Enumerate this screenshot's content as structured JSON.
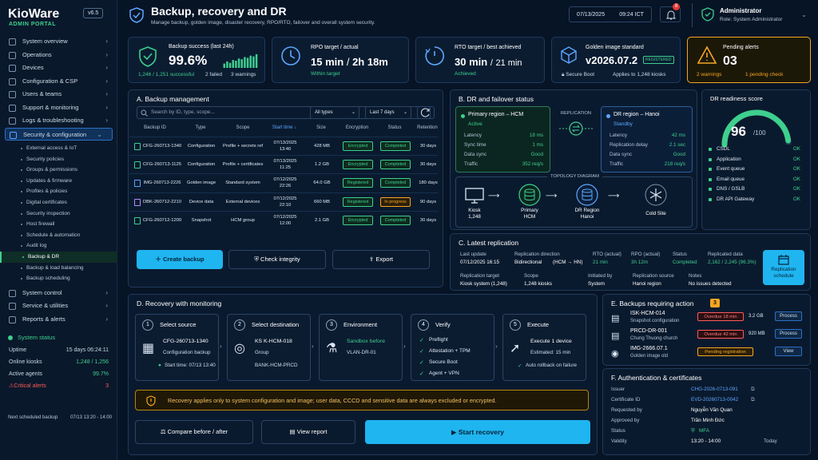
{
  "sidebar": {
    "logo": "KioWare",
    "logo_sub": "ADMIN PORTAL",
    "version": "v6.5",
    "items": [
      {
        "label": "System overview"
      },
      {
        "label": "Operations"
      },
      {
        "label": "Devices"
      },
      {
        "label": "Configuration & CSP"
      },
      {
        "label": "Users & teams"
      },
      {
        "label": "Support & monitoring"
      },
      {
        "label": "Logs & troubleshooting"
      },
      {
        "label": "Security & configuration"
      }
    ],
    "subitems": [
      "External access & IoT",
      "Security policies",
      "Groups & permissions",
      "Updates & firmware",
      "Profiles & policies",
      "Digital certificates",
      "Security inspection",
      "Host firewall",
      "Schedule & automation",
      "Audit log",
      "Backup & DR",
      "Backup & load balancing",
      "Backup scheduling"
    ],
    "bottom_items": [
      {
        "label": "System control"
      },
      {
        "label": "Service & utilities"
      },
      {
        "label": "Reports & alerts"
      }
    ],
    "status": {
      "title": "System status",
      "rows": [
        {
          "k": "Uptime",
          "v": "15 days 06:24:11"
        },
        {
          "k": "Online kiosks",
          "v": "1,248 / 1,256"
        },
        {
          "k": "Active agents",
          "v": "99.7%"
        },
        {
          "k": "Critical alerts",
          "v": "3"
        }
      ],
      "sched_label": "Next scheduled backup",
      "sched_value": "07/13 13:20 - 14:00"
    }
  },
  "header": {
    "title": "Backup, recovery and DR",
    "subtitle": "Manage backup, golden image, disaster recovery, RPO/RTO, failover and overall system security.",
    "date": "07/13/2025",
    "time": "09:24 ICT",
    "notif": "8",
    "user_name": "Administrator",
    "user_role": "Role: System Administrator"
  },
  "kpis": {
    "backup": {
      "title": "Backup success (last 24h)",
      "value": "99.6%",
      "ok": "1,246 / 1,251 successful",
      "failed": "2 failed",
      "warn": "3 warnings",
      "bars": [
        0.3,
        0.45,
        0.35,
        0.55,
        0.5,
        0.65,
        0.6,
        0.75,
        0.7,
        0.85,
        0.8,
        0.95
      ]
    },
    "rpo": {
      "title": "RPO target / actual",
      "value": "15 min",
      "value2": "2h 18m",
      "status": "Within target"
    },
    "rto": {
      "title": "RTO target / best achieved",
      "value": "30 min",
      "value2": "21 min",
      "status": "Achieved"
    },
    "golden": {
      "title": "Golden image standard",
      "value": "v2026.07.2",
      "badge": "REGISTERED",
      "s1": "Secure Boot",
      "s2": "Applies to 1,248 kiosks"
    },
    "alerts": {
      "title": "Pending alerts",
      "value": "03",
      "s1": "2 warnings",
      "s2": "1 pending check"
    }
  },
  "backup": {
    "title": "A. Backup management",
    "search_placeholder": "Search by ID, type, scope...",
    "filter_type": "All types",
    "filter_date": "Last 7 days",
    "columns": [
      "Backup ID",
      "Type",
      "Scope",
      "Start time",
      "Size",
      "Encryption",
      "Status",
      "Retention"
    ],
    "rows": [
      {
        "id": "CFG-260713-1340",
        "type": "Configuration",
        "scope": "Profile + secrets ref",
        "d": "07/13/2025",
        "t": "13:40",
        "size": "428 MB",
        "enc": "Encrypted",
        "status": "Completed",
        "ret": "30 days"
      },
      {
        "id": "CFG-260713-1125",
        "type": "Configuration",
        "scope": "Profile + certificates",
        "d": "07/13/2025",
        "t": "11:25",
        "size": "1.2 GB",
        "enc": "Encrypted",
        "status": "Completed",
        "ret": "30 days"
      },
      {
        "id": "IMG-260713-2226",
        "type": "Golden image",
        "scope": "Standard system",
        "d": "07/12/2025",
        "t": "22:26",
        "size": "64.0 GB",
        "enc": "Registered",
        "status": "Completed",
        "ret": "180 days"
      },
      {
        "id": "DBK-260712-2210",
        "type": "Device data",
        "scope": "External devices",
        "d": "07/12/2025",
        "t": "22:10",
        "size": "660 MB",
        "enc": "Registered",
        "status": "In progress",
        "ret": "90 days"
      },
      {
        "id": "CFG-260712-1200",
        "type": "Snapshot",
        "scope": "HCM group",
        "d": "07/12/2025",
        "t": "12:00",
        "size": "2.1 GB",
        "enc": "Encrypted",
        "status": "Completed",
        "ret": "30 days"
      }
    ],
    "btn_create": "Create backup",
    "btn_check": "Check integrity",
    "btn_export": "Export"
  },
  "dr": {
    "title": "B. DR and failover status",
    "primary": {
      "name": "Primary region – HCM",
      "state": "Active",
      "rows": [
        {
          "k": "Latency",
          "v": "18 ms"
        },
        {
          "k": "Sync time",
          "v": "1 ms"
        },
        {
          "k": "Data sync",
          "v": "Good"
        },
        {
          "k": "Traffic",
          "v": "352 req/s"
        }
      ]
    },
    "replication": "REPLICATION",
    "secondary": {
      "name": "DR region – Hanoi",
      "state": "Standby",
      "rows": [
        {
          "k": "Latency",
          "v": "42 ms"
        },
        {
          "k": "Replication delay",
          "v": "2.1 sec"
        },
        {
          "k": "Data sync",
          "v": "Good"
        },
        {
          "k": "Traffic",
          "v": "218 req/s"
        }
      ]
    },
    "topology": "TOPOLOGY DIAGRAM",
    "nodes": [
      {
        "l": "Kiosk",
        "s": "1,248"
      },
      {
        "l": "Primary",
        "s": "HCM"
      },
      {
        "l": "DR Region",
        "s": "Hanoi"
      },
      {
        "l": "Cold Site",
        "s": ""
      }
    ],
    "readiness": {
      "title": "DR readiness score",
      "score": "96",
      "max": "/100",
      "score_value": 96,
      "items": [
        {
          "k": "CSDL",
          "v": "OK"
        },
        {
          "k": "Application",
          "v": "OK"
        },
        {
          "k": "Event queue",
          "v": "OK"
        },
        {
          "k": "Email queue",
          "v": "OK"
        },
        {
          "k": "DNS / GSLB",
          "v": "OK"
        },
        {
          "k": "DR API Gateway",
          "v": "OK"
        }
      ]
    }
  },
  "latest": {
    "title": "C. Latest replication",
    "r1": [
      {
        "k": "Last update",
        "v": "07/12/2025 16:15"
      },
      {
        "k": "Replication direction",
        "v": "Bidirectional"
      },
      {
        "k": "RTO (actual)",
        "v": "21 min"
      },
      {
        "k": "RPO (actual)",
        "v": "3h 12m"
      },
      {
        "k": "Status",
        "v": "Completed"
      },
      {
        "k": "Replicated data",
        "v": "2,162 / 2,245 (96.3%)"
      }
    ],
    "dir_detail": "(HCM → HN)",
    "r2": [
      {
        "k": "Replication target",
        "v": "Kiosk system (1,248)"
      },
      {
        "k": "Scope",
        "v": "1,248 kiosks"
      },
      {
        "k": "Initiated by",
        "v": "System"
      },
      {
        "k": "Replication source",
        "v": "Hanoi region"
      },
      {
        "k": "Notes",
        "v": "No issues detected"
      }
    ],
    "btn": "Replication schedule"
  },
  "recovery": {
    "title": "D. Recovery with monitoring",
    "steps": [
      {
        "n": "1",
        "t": "Select source",
        "a": "CFG-260713-1340",
        "b": "Configuration backup",
        "c": "Start time: 07/13 13:40"
      },
      {
        "n": "2",
        "t": "Select destination",
        "a": "KS K-HCM-018",
        "b": "Group",
        "c": "BANK-HCM-PRCD"
      },
      {
        "n": "3",
        "t": "Environment",
        "a": "Sandbox before",
        "b": "VLAN-DR-01",
        "c": ""
      },
      {
        "n": "4",
        "t": "Verify",
        "a": "Preflight",
        "b": "Attestation + TPM",
        "c": "Secure Boot",
        "d": "Agent + VPN"
      },
      {
        "n": "5",
        "t": "Execute",
        "a": "Execute 1 device",
        "b": "Estimated: 15 min",
        "c": "Auto rollback on failure"
      }
    ],
    "notice": "Recovery applies only to system configuration and image; user data, CCCD and sensitive data are always excluded or encrypted.",
    "btn_compare": "Compare before / after",
    "btn_report": "View report",
    "btn_start": "Start recovery"
  },
  "action": {
    "title": "E. Backups requiring action",
    "count": "3",
    "rows": [
      {
        "id": "ISK-HCM-014",
        "d": "Snapshot configuration",
        "tag": "Overdue 18 min",
        "size": "3.2 GB",
        "btn": "Process"
      },
      {
        "id": "PRCD-DR-001",
        "d": "Chung Thuong church",
        "tag": "Overdue 42 min",
        "size": "920 MB",
        "btn": "Process"
      },
      {
        "id": "IMG-2666.07.1",
        "d": "Golden image old",
        "tag": "Pending registration",
        "size": "",
        "btn": "View"
      }
    ]
  },
  "auth": {
    "title": "F. Authentication & certificates",
    "rows": [
      {
        "k": "Issuer",
        "v": "CHG-2026-0713-091"
      },
      {
        "k": "Certificate ID",
        "v": "EVD-20260713-0042"
      },
      {
        "k": "Requested by",
        "v": "Nguyễn Văn Quan"
      },
      {
        "k": "Approved by",
        "v": "Trần Minh Đức"
      },
      {
        "k": "Status",
        "v": "MFA"
      },
      {
        "k": "Validity",
        "v": "13:20 - 14:00"
      }
    ],
    "today": "Today"
  }
}
